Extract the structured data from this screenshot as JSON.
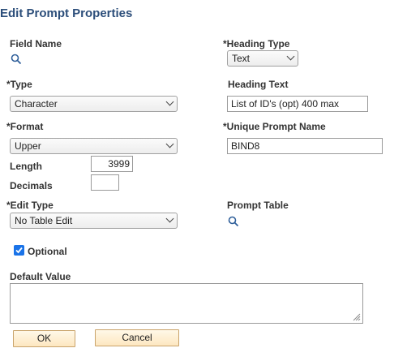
{
  "dialog": {
    "title": "Edit Prompt Properties"
  },
  "fields": {
    "field_name_label": "Field Name",
    "heading_type_label": "*Heading Type",
    "heading_type_value": "Text",
    "type_label": "*Type",
    "type_value": "Character",
    "heading_text_label": "Heading Text",
    "heading_text_value": "List of ID's (opt) 400 max",
    "format_label": "*Format",
    "format_value": "Upper",
    "unique_prompt_label": "*Unique Prompt Name",
    "unique_prompt_value": "BIND8",
    "length_label": "Length",
    "length_value": "3999",
    "decimals_label": "Decimals",
    "decimals_value": "",
    "edit_type_label": "*Edit Type",
    "edit_type_value": "No Table Edit",
    "prompt_table_label": "Prompt Table",
    "optional_label": "Optional",
    "optional_checked": true,
    "default_value_label": "Default Value",
    "default_value": ""
  },
  "buttons": {
    "ok": "OK",
    "cancel": "Cancel"
  },
  "icons": {
    "lookup": "magnifier-icon",
    "dropdown": "chevron-down-icon",
    "check": "checkmark-icon"
  },
  "colors": {
    "title": "#2c4e7a",
    "checkbox": "#1a73e8",
    "button_border": "#c9a36a"
  }
}
